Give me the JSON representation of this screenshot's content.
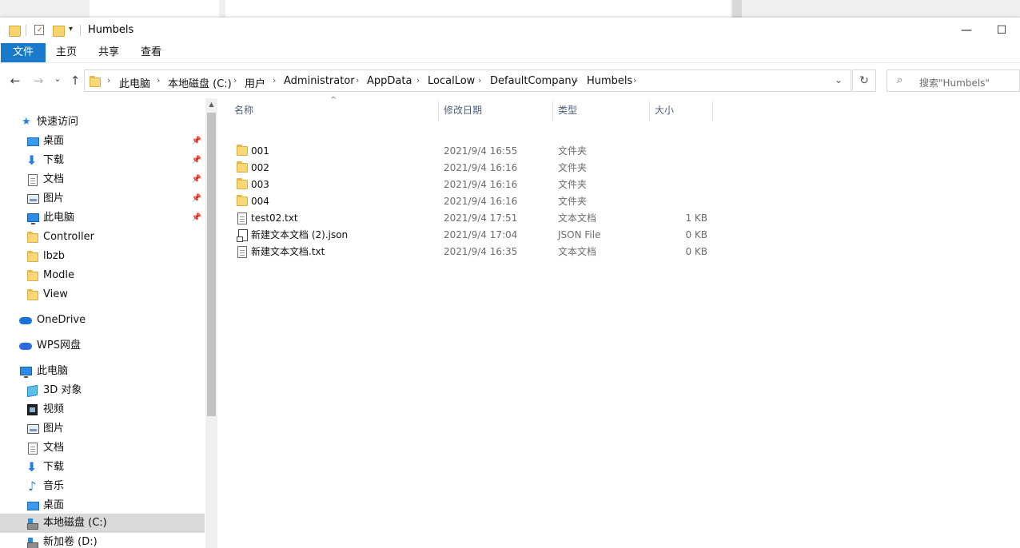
{
  "window": {
    "title": "Humbels",
    "minimize": "—",
    "maximize": "☐"
  },
  "ribbon": {
    "tabs": [
      "文件",
      "主页",
      "共享",
      "查看"
    ]
  },
  "nav": {
    "back": "←",
    "forward": "→",
    "recent": "⌄",
    "up": "↑",
    "breadcrumbs": [
      "此电脑",
      "本地磁盘 (C:)",
      "用户",
      "Administrator",
      "AppData",
      "LocalLow",
      "DefaultCompany",
      "Humbels"
    ],
    "crumb_sep": "›",
    "dropdown": "⌄",
    "refresh": "↻",
    "search_placeholder": "搜索\"Humbels\"",
    "search_icon": "⌕"
  },
  "sidebar": {
    "quick_access": "快速访问",
    "quick_items": [
      {
        "label": "桌面",
        "icon": "desktop-icon",
        "pinned": true
      },
      {
        "label": "下载",
        "icon": "download-icon",
        "pinned": true
      },
      {
        "label": "文档",
        "icon": "document-icon",
        "pinned": true
      },
      {
        "label": "图片",
        "icon": "picture-icon",
        "pinned": true
      },
      {
        "label": "此电脑",
        "icon": "computer-icon",
        "pinned": true
      },
      {
        "label": "Controller",
        "icon": "folder-icon",
        "pinned": false
      },
      {
        "label": "lbzb",
        "icon": "folder-icon",
        "pinned": false
      },
      {
        "label": "Modle",
        "icon": "folder-icon",
        "pinned": false
      },
      {
        "label": "View",
        "icon": "folder-icon",
        "pinned": false
      }
    ],
    "onedrive": "OneDrive",
    "wps": "WPS网盘",
    "this_pc": "此电脑",
    "pc_items": [
      {
        "label": "3D 对象",
        "icon": "3d-objects-icon"
      },
      {
        "label": "视频",
        "icon": "video-icon"
      },
      {
        "label": "图片",
        "icon": "picture-icon"
      },
      {
        "label": "文档",
        "icon": "document-icon"
      },
      {
        "label": "下载",
        "icon": "download-icon"
      },
      {
        "label": "音乐",
        "icon": "music-icon"
      },
      {
        "label": "桌面",
        "icon": "desktop-icon"
      },
      {
        "label": "本地磁盘 (C:)",
        "icon": "drive-icon",
        "selected": true
      },
      {
        "label": "新加卷 (D:)",
        "icon": "drive-icon"
      }
    ],
    "pin_glyph": "📌"
  },
  "columns": {
    "name": "名称",
    "date": "修改日期",
    "type": "类型",
    "size": "大小",
    "sort_arrow": "^"
  },
  "files": [
    {
      "name": "001",
      "date": "2021/9/4 16:55",
      "type": "文件夹",
      "size": "",
      "kind": "folder"
    },
    {
      "name": "002",
      "date": "2021/9/4 16:16",
      "type": "文件夹",
      "size": "",
      "kind": "folder"
    },
    {
      "name": "003",
      "date": "2021/9/4 16:16",
      "type": "文件夹",
      "size": "",
      "kind": "folder"
    },
    {
      "name": "004",
      "date": "2021/9/4 16:16",
      "type": "文件夹",
      "size": "",
      "kind": "folder"
    },
    {
      "name": "test02.txt",
      "date": "2021/9/4 17:51",
      "type": "文本文档",
      "size": "1 KB",
      "kind": "txt"
    },
    {
      "name": "新建文本文档 (2).json",
      "date": "2021/9/4 17:04",
      "type": "JSON File",
      "size": "0 KB",
      "kind": "json"
    },
    {
      "name": "新建文本文档.txt",
      "date": "2021/9/4 16:35",
      "type": "文本文档",
      "size": "0 KB",
      "kind": "txt"
    }
  ],
  "scrollbar": {
    "up_arrow": "▲"
  }
}
